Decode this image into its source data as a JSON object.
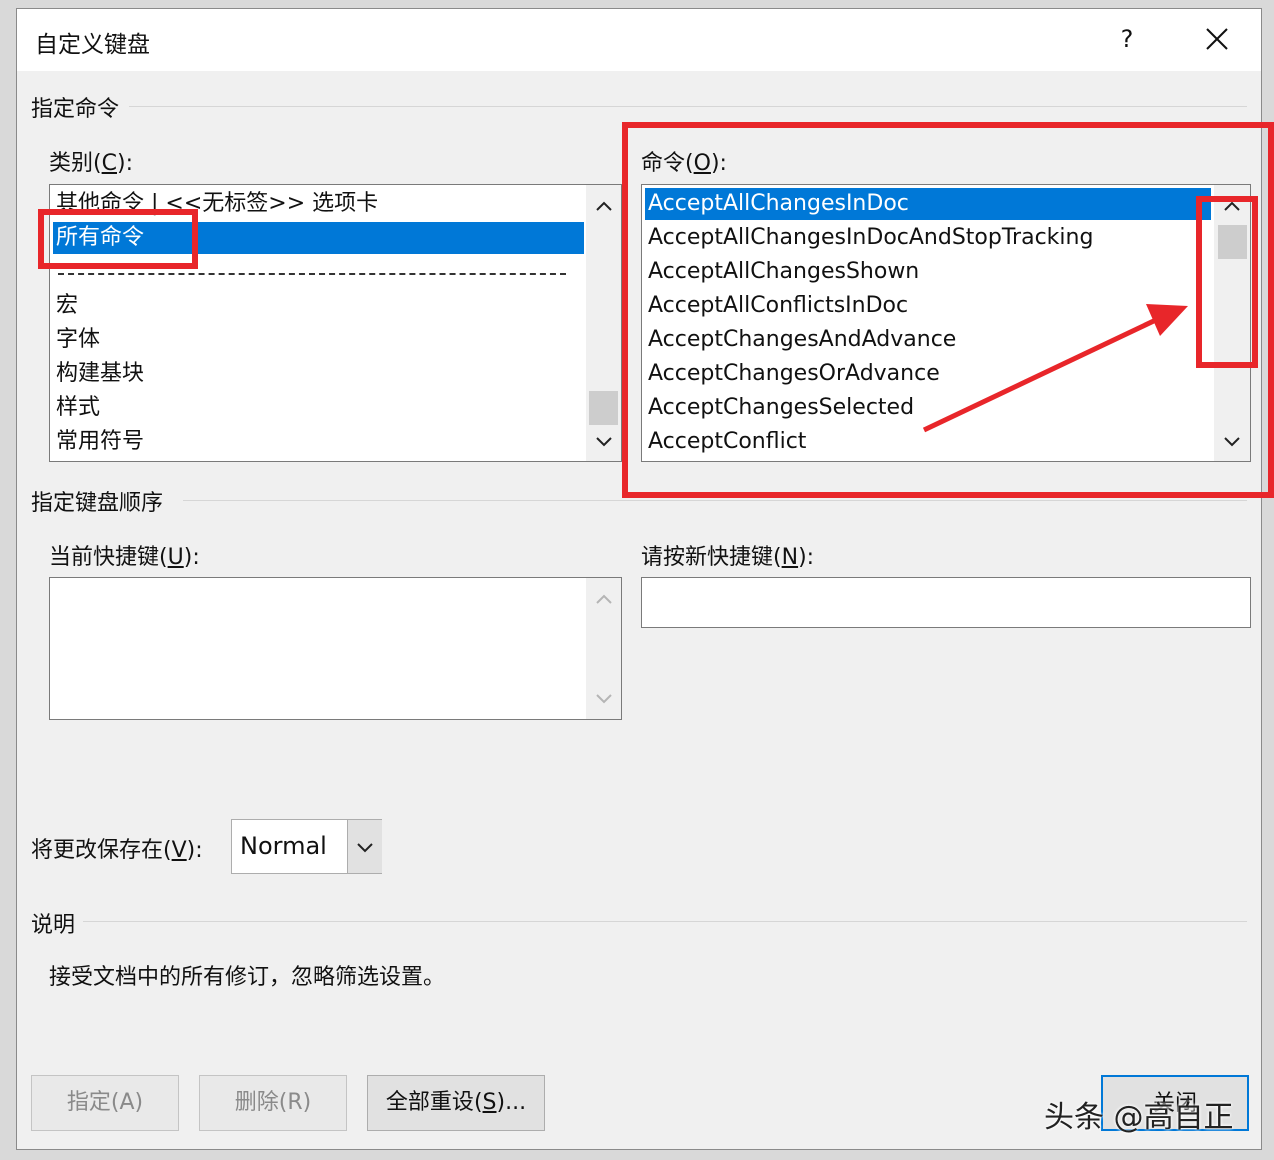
{
  "dialog": {
    "title": "自定义键盘",
    "help_label": "?"
  },
  "assign_command": {
    "group_label": "指定命令",
    "categories": {
      "label": "类别",
      "accel": "C",
      "label_suffix": ":",
      "items": [
        "其他命令 | <<无标签>> 选项卡",
        "所有命令",
        "宏",
        "字体",
        "构建基块",
        "样式",
        "常用符号"
      ],
      "selected": "所有命令"
    },
    "commands": {
      "label": "命令",
      "accel": "O",
      "label_suffix": ":",
      "items": [
        "AcceptAllChangesInDoc",
        "AcceptAllChangesInDocAndStopTracking",
        "AcceptAllChangesShown",
        "AcceptAllConflictsInDoc",
        "AcceptChangesAndAdvance",
        "AcceptChangesOrAdvance",
        "AcceptChangesSelected",
        "AcceptConflict"
      ],
      "selected": "AcceptAllChangesInDoc"
    }
  },
  "keyboard_sequence": {
    "group_label": "指定键盘顺序",
    "current_keys": {
      "label": "当前快捷键",
      "accel": "U",
      "label_suffix": ":"
    },
    "new_key": {
      "label": "请按新快捷键",
      "accel": "N",
      "label_suffix": ":",
      "value": ""
    }
  },
  "save_in": {
    "label": "将更改保存在",
    "accel": "V",
    "label_suffix": ":",
    "value": "Normal"
  },
  "description": {
    "group_label": "说明",
    "text": "接受文档中的所有修订，忽略筛选设置。"
  },
  "buttons": {
    "assign": "指定(A)",
    "remove": "删除(R)",
    "reset_all": {
      "label": "全部重设",
      "accel": "S",
      "suffix": "..."
    },
    "close": "关闭"
  },
  "watermark": "头条 @高自正",
  "colors": {
    "selection": "#0078d7",
    "annotation": "#e8262a"
  }
}
